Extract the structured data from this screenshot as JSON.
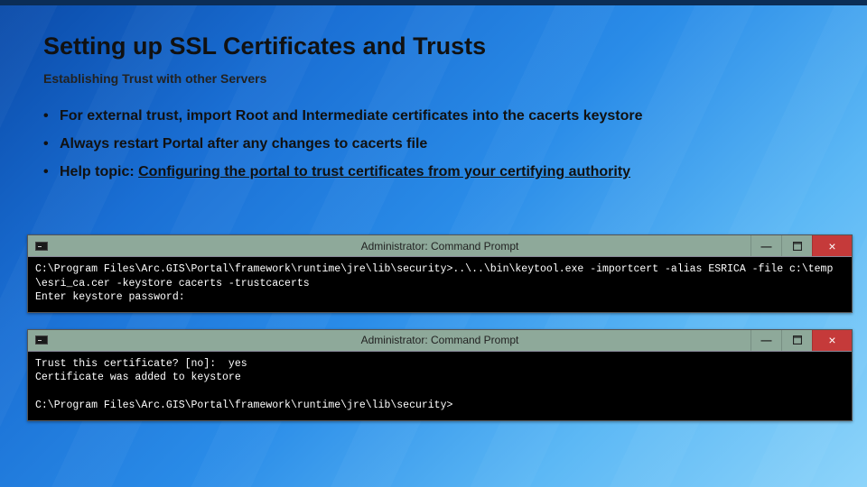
{
  "title": "Setting up SSL Certificates and Trusts",
  "subtitle": "Establishing Trust with other Servers",
  "bullets": {
    "b1": "For external trust, import Root and Intermediate certificates into the cacerts keystore",
    "b2": "Always restart Portal after any changes to cacerts file",
    "b3_label": "Help topic: ",
    "b3_link": "Configuring the portal to trust certificates from your certifying authority"
  },
  "cmd": {
    "window_title": "Administrator: Command Prompt",
    "min": "—",
    "close": "×"
  },
  "console1": {
    "line1": "C:\\Program Files\\Arc.GIS\\Portal\\framework\\runtime\\jre\\lib\\security>..\\..\\bin\\keytool.exe -importcert -alias ESRICA -file c:\\temp\\esri_ca.cer -keystore cacerts -trustcacerts",
    "line2": "Enter keystore password:"
  },
  "console2": {
    "line1": "Trust this certificate? [no]:  yes",
    "line2": "Certificate was added to keystore",
    "line3": " ",
    "line4": "C:\\Program Files\\Arc.GIS\\Portal\\framework\\runtime\\jre\\lib\\security>"
  }
}
